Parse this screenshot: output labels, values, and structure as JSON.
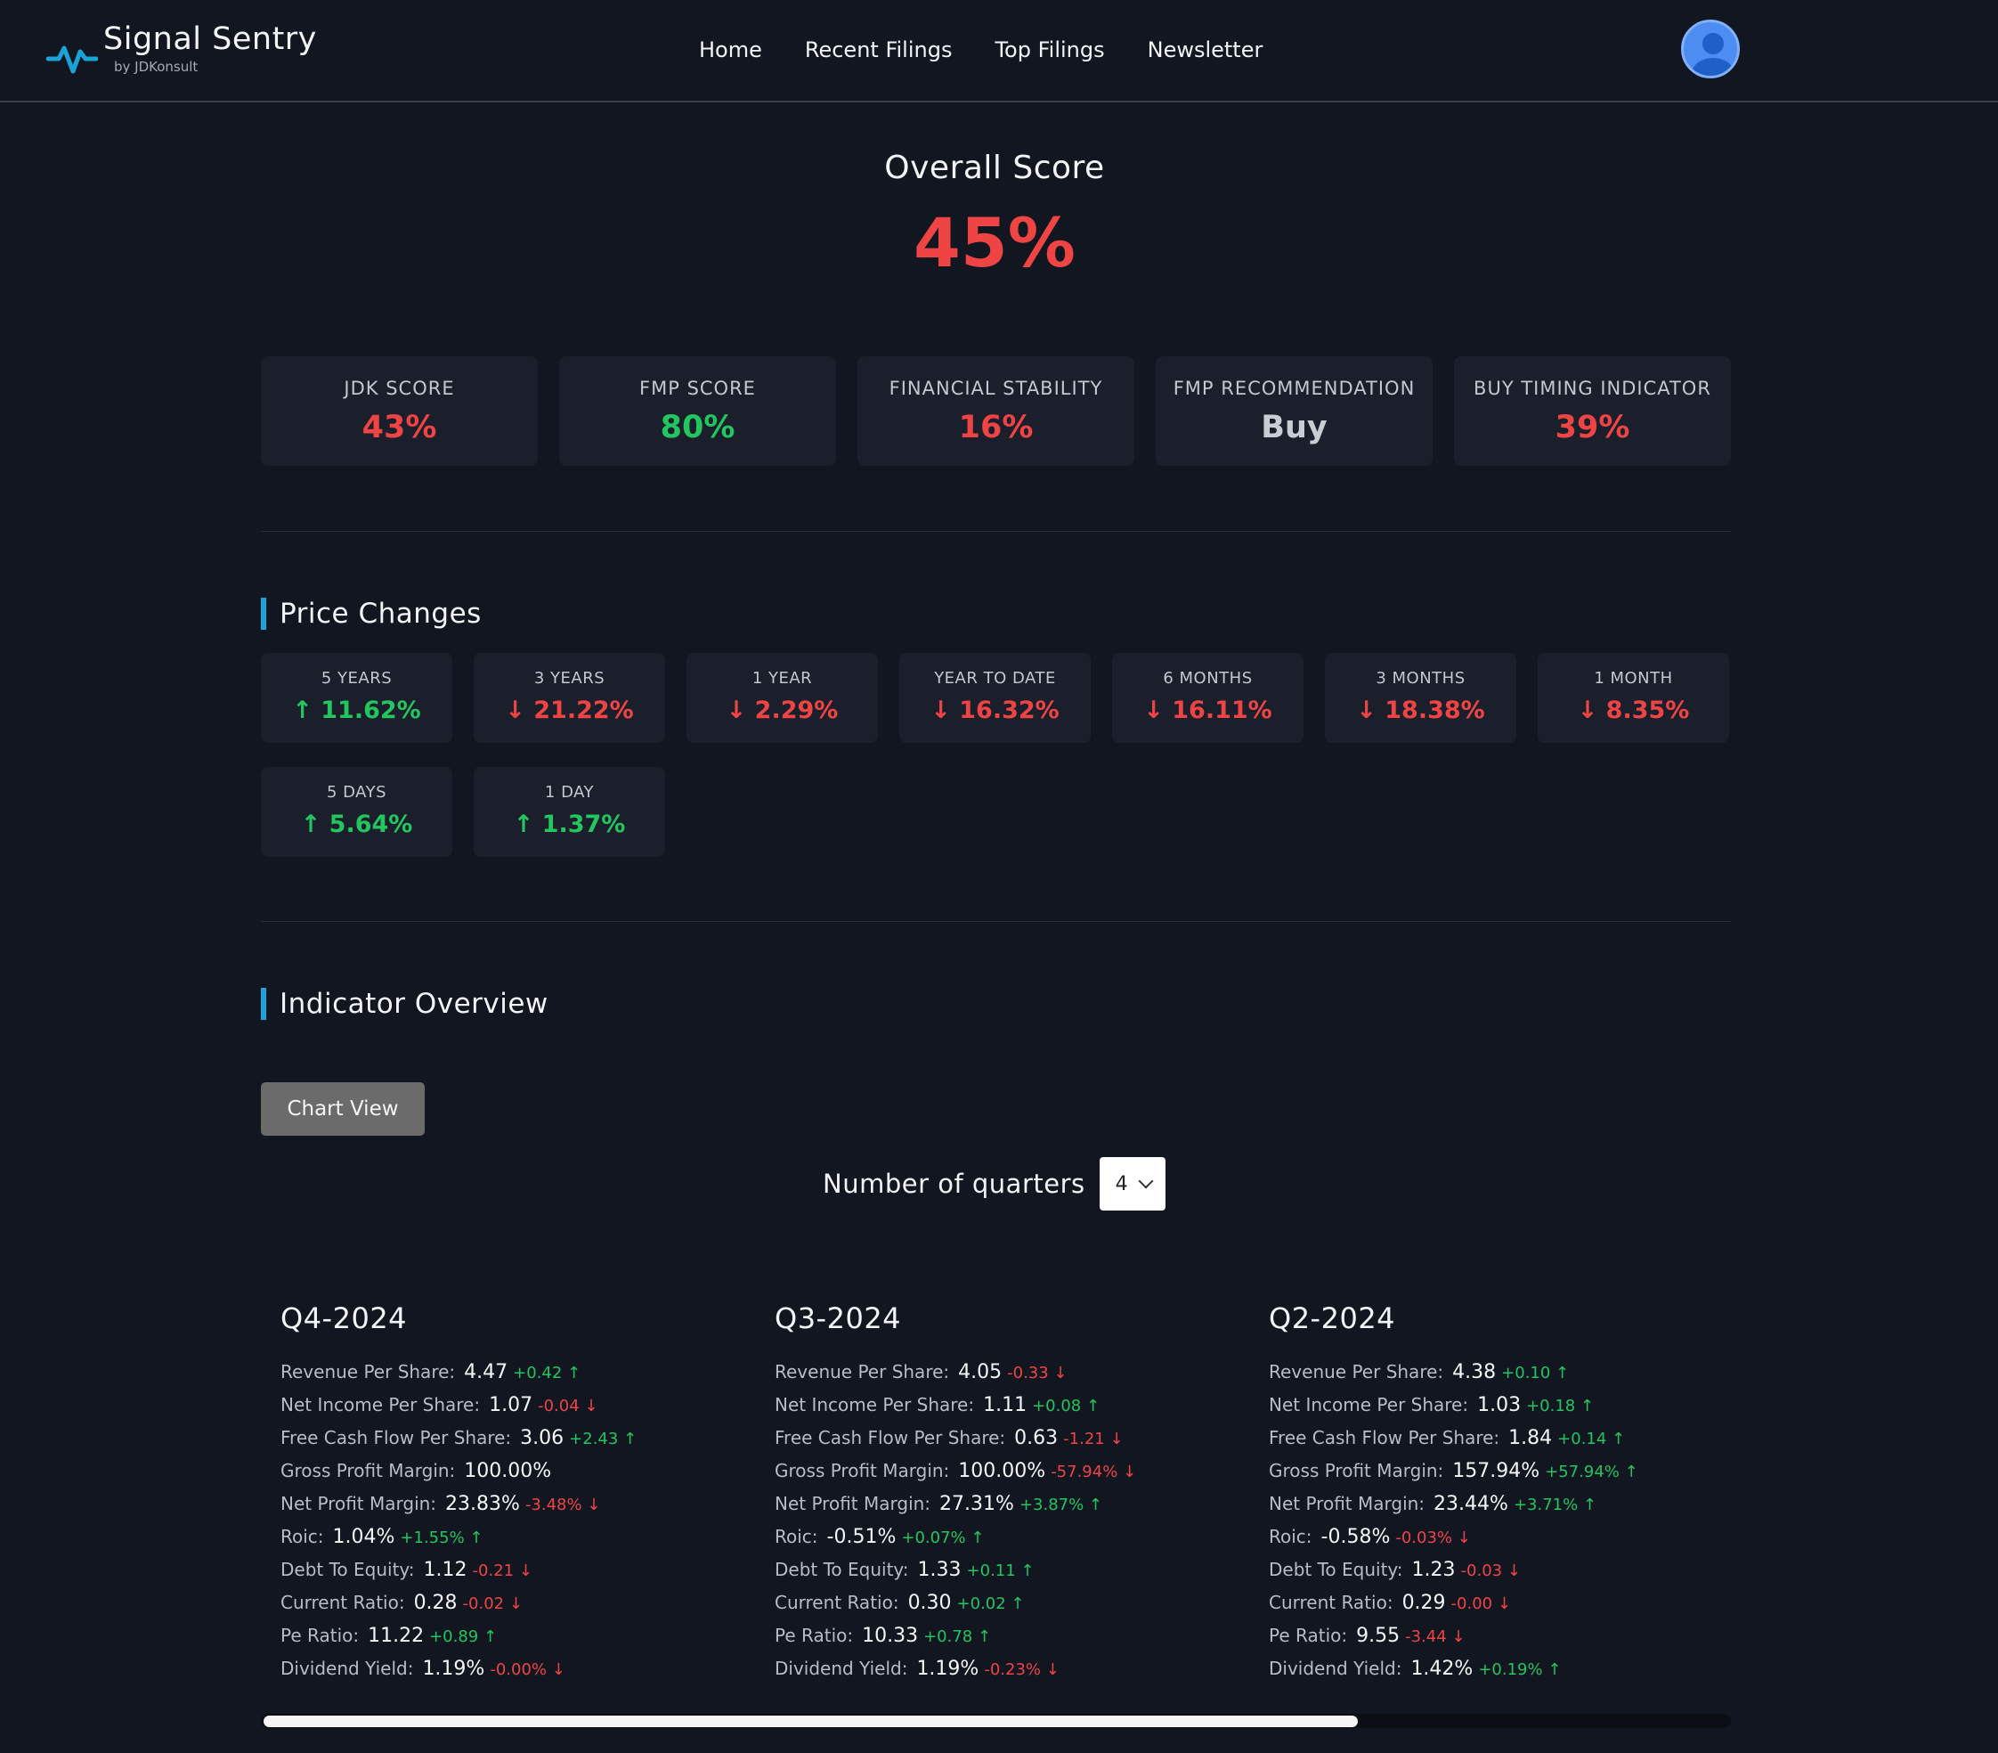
{
  "app": {
    "brand": "Signal Sentry",
    "byline": "by JDKonsult"
  },
  "nav": {
    "links": [
      "Home",
      "Recent Filings",
      "Top Filings",
      "Newsletter"
    ]
  },
  "overall": {
    "label": "Overall Score",
    "value": "45%"
  },
  "scores": [
    {
      "label": "JDK SCORE",
      "value": "43%",
      "color": "#ef4444"
    },
    {
      "label": "FMP SCORE",
      "value": "80%",
      "color": "#22c55e"
    },
    {
      "label": "FINANCIAL STABILITY",
      "value": "16%",
      "color": "#ef4444"
    },
    {
      "label": "FMP RECOMMENDATION",
      "value": "Buy",
      "color": "#c9ccd2"
    },
    {
      "label": "BUY TIMING INDICATOR",
      "value": "39%",
      "color": "#ef4444"
    }
  ],
  "price_changes": {
    "title": "Price Changes",
    "items": [
      {
        "label": "5 YEARS",
        "value": "↑ 11.62%",
        "direction": "up"
      },
      {
        "label": "3 YEARS",
        "value": "↓ 21.22%",
        "direction": "down"
      },
      {
        "label": "1 YEAR",
        "value": "↓ 2.29%",
        "direction": "down"
      },
      {
        "label": "YEAR TO DATE",
        "value": "↓ 16.32%",
        "direction": "down"
      },
      {
        "label": "6 MONTHS",
        "value": "↓ 16.11%",
        "direction": "down"
      },
      {
        "label": "3 MONTHS",
        "value": "↓ 18.38%",
        "direction": "down"
      },
      {
        "label": "1 MONTH",
        "value": "↓ 8.35%",
        "direction": "down"
      },
      {
        "label": "5 DAYS",
        "value": "↑ 5.64%",
        "direction": "up"
      },
      {
        "label": "1 DAY",
        "value": "↑ 1.37%",
        "direction": "up"
      }
    ]
  },
  "indicator_overview": {
    "title": "Indicator Overview",
    "chart_button": "Chart View",
    "quarters_label": "Number of quarters",
    "quarters_value": "4"
  },
  "quarters": [
    {
      "title": "Q4-2024",
      "rows": [
        {
          "key": "Revenue Per Share:",
          "value": "4.47",
          "delta": "+0.42 ↑",
          "direction": "up"
        },
        {
          "key": "Net Income Per Share:",
          "value": "1.07",
          "delta": "-0.04 ↓",
          "direction": "down"
        },
        {
          "key": "Free Cash Flow Per Share:",
          "value": "3.06",
          "delta": "+2.43 ↑",
          "direction": "up"
        },
        {
          "key": "Gross Profit Margin:",
          "value": "100.00%",
          "delta": "",
          "direction": "none"
        },
        {
          "key": "Net Profit Margin:",
          "value": "23.83%",
          "delta": "-3.48% ↓",
          "direction": "down"
        },
        {
          "key": "Roic:",
          "value": "1.04%",
          "delta": "+1.55% ↑",
          "direction": "up"
        },
        {
          "key": "Debt To Equity:",
          "value": "1.12",
          "delta": "-0.21 ↓",
          "direction": "down"
        },
        {
          "key": "Current Ratio:",
          "value": "0.28",
          "delta": "-0.02 ↓",
          "direction": "down"
        },
        {
          "key": "Pe Ratio:",
          "value": "11.22",
          "delta": "+0.89 ↑",
          "direction": "up"
        },
        {
          "key": "Dividend Yield:",
          "value": "1.19%",
          "delta": "-0.00% ↓",
          "direction": "down"
        }
      ]
    },
    {
      "title": "Q3-2024",
      "rows": [
        {
          "key": "Revenue Per Share:",
          "value": "4.05",
          "delta": "-0.33 ↓",
          "direction": "down"
        },
        {
          "key": "Net Income Per Share:",
          "value": "1.11",
          "delta": "+0.08 ↑",
          "direction": "up"
        },
        {
          "key": "Free Cash Flow Per Share:",
          "value": "0.63",
          "delta": "-1.21 ↓",
          "direction": "down"
        },
        {
          "key": "Gross Profit Margin:",
          "value": "100.00%",
          "delta": "-57.94% ↓",
          "direction": "down"
        },
        {
          "key": "Net Profit Margin:",
          "value": "27.31%",
          "delta": "+3.87% ↑",
          "direction": "up"
        },
        {
          "key": "Roic:",
          "value": "-0.51%",
          "delta": "+0.07% ↑",
          "direction": "up"
        },
        {
          "key": "Debt To Equity:",
          "value": "1.33",
          "delta": "+0.11 ↑",
          "direction": "up"
        },
        {
          "key": "Current Ratio:",
          "value": "0.30",
          "delta": "+0.02 ↑",
          "direction": "up"
        },
        {
          "key": "Pe Ratio:",
          "value": "10.33",
          "delta": "+0.78 ↑",
          "direction": "up"
        },
        {
          "key": "Dividend Yield:",
          "value": "1.19%",
          "delta": "-0.23% ↓",
          "direction": "down"
        }
      ]
    },
    {
      "title": "Q2-2024",
      "rows": [
        {
          "key": "Revenue Per Share:",
          "value": "4.38",
          "delta": "+0.10 ↑",
          "direction": "up"
        },
        {
          "key": "Net Income Per Share:",
          "value": "1.03",
          "delta": "+0.18 ↑",
          "direction": "up"
        },
        {
          "key": "Free Cash Flow Per Share:",
          "value": "1.84",
          "delta": "+0.14 ↑",
          "direction": "up"
        },
        {
          "key": "Gross Profit Margin:",
          "value": "157.94%",
          "delta": "+57.94% ↑",
          "direction": "up"
        },
        {
          "key": "Net Profit Margin:",
          "value": "23.44%",
          "delta": "+3.71% ↑",
          "direction": "up"
        },
        {
          "key": "Roic:",
          "value": "-0.58%",
          "delta": "-0.03% ↓",
          "direction": "down"
        },
        {
          "key": "Debt To Equity:",
          "value": "1.23",
          "delta": "-0.03 ↓",
          "direction": "down"
        },
        {
          "key": "Current Ratio:",
          "value": "0.29",
          "delta": "-0.00 ↓",
          "direction": "down"
        },
        {
          "key": "Pe Ratio:",
          "value": "9.55",
          "delta": "-3.44 ↓",
          "direction": "down"
        },
        {
          "key": "Dividend Yield:",
          "value": "1.42%",
          "delta": "+0.19% ↑",
          "direction": "up"
        }
      ]
    }
  ],
  "icons": {
    "logo": "pulse-icon",
    "avatar": "user-avatar-icon",
    "select": "chevron-down-icon"
  }
}
